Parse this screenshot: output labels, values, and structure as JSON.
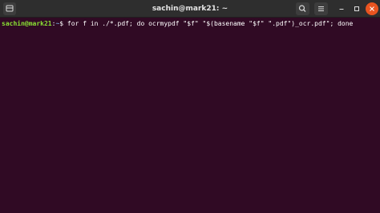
{
  "window": {
    "title": "sachin@mark21: ~",
    "accent_color": "#e95420",
    "background_color": "#300a24"
  },
  "titlebar": {
    "new_tab_icon": "new-tab-icon",
    "search_icon": "search-icon",
    "menu_icon": "hamburger-menu-icon",
    "minimize_icon": "minimize-icon",
    "maximize_icon": "maximize-icon",
    "close_icon": "close-icon"
  },
  "terminal": {
    "prompt": {
      "user_host": "sachin@mark21",
      "separator": ":",
      "path": "~",
      "dollar": "$"
    },
    "command": " for f in ./*.pdf; do ocrmypdf \"$f\" \"$(basename \"$f\" \".pdf\")_ocr.pdf\"; done"
  }
}
